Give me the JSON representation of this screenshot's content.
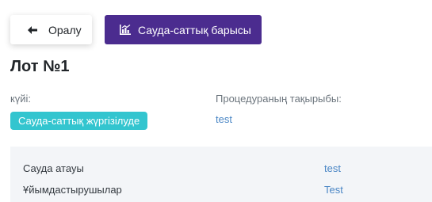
{
  "toolbar": {
    "back_label": "Оралу",
    "progress_label": "Сауда-саттық барысы",
    "accent_color": "#4b2c8f"
  },
  "page": {
    "title": "Лот №1"
  },
  "status": {
    "label": "күйі:",
    "value": "Сауда-саттық жүргізілуде",
    "badge_color": "#33c5cf"
  },
  "topic": {
    "label": "Процедураның тақырыбы:",
    "value": "test"
  },
  "details": [
    {
      "key": "Сауда атауы",
      "value": "test"
    },
    {
      "key": "Ұйымдастырушылар",
      "value": "Test"
    }
  ]
}
